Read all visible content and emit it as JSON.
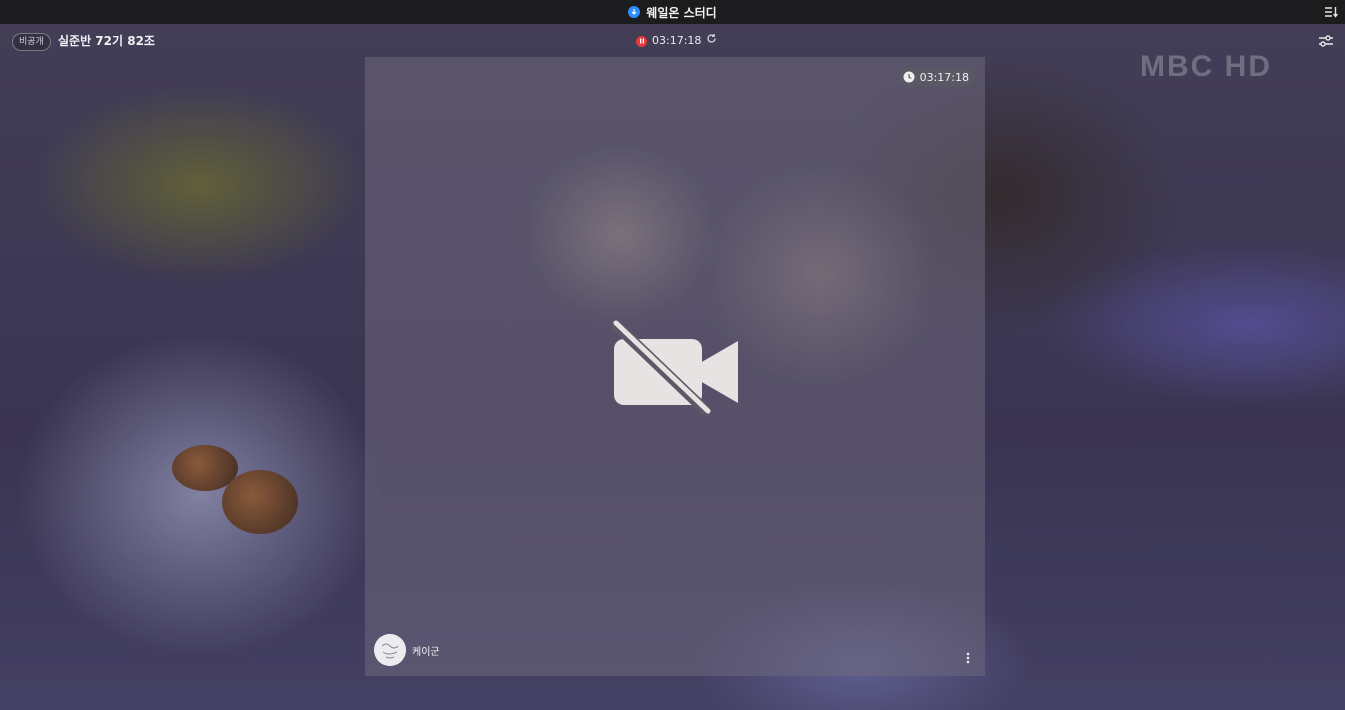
{
  "app": {
    "title": "웨일온 스터디",
    "accent_color": "#2f8cff"
  },
  "header": {
    "visibility_badge": "비공개",
    "room_title": "실준반 72기 82조",
    "elapsed_time": "03:17:18",
    "pause_icon": "pause-icon",
    "refresh_icon": "refresh-icon",
    "settings_icon": "sliders-icon"
  },
  "tile": {
    "timer": "03:17:18",
    "camera_state_icon": "camera-off-icon",
    "user_name": "케이군",
    "menu_icon": "more-vertical-icon"
  },
  "background": {
    "watermark": "MBC HD"
  }
}
